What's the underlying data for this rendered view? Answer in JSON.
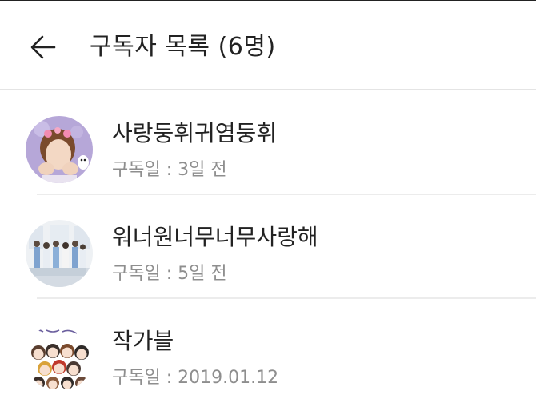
{
  "header": {
    "back_icon": "arrow-left-icon",
    "title": "구독자 목록 (6명)"
  },
  "subscribers": [
    {
      "name": "사랑둥휘귀염둥휘",
      "date": "구독일 : 3일 전",
      "avatar": "avatar-photo"
    },
    {
      "name": "워너원너무너무사랑해",
      "date": "구독일 : 5일 전",
      "avatar": "avatar-photo"
    },
    {
      "name": "작가블",
      "date": "구독일 : 2019.01.12",
      "avatar": "avatar-drawing"
    }
  ],
  "colors": {
    "title": "#222222",
    "subtitle": "#8e8e8e",
    "divider": "#ececec"
  }
}
